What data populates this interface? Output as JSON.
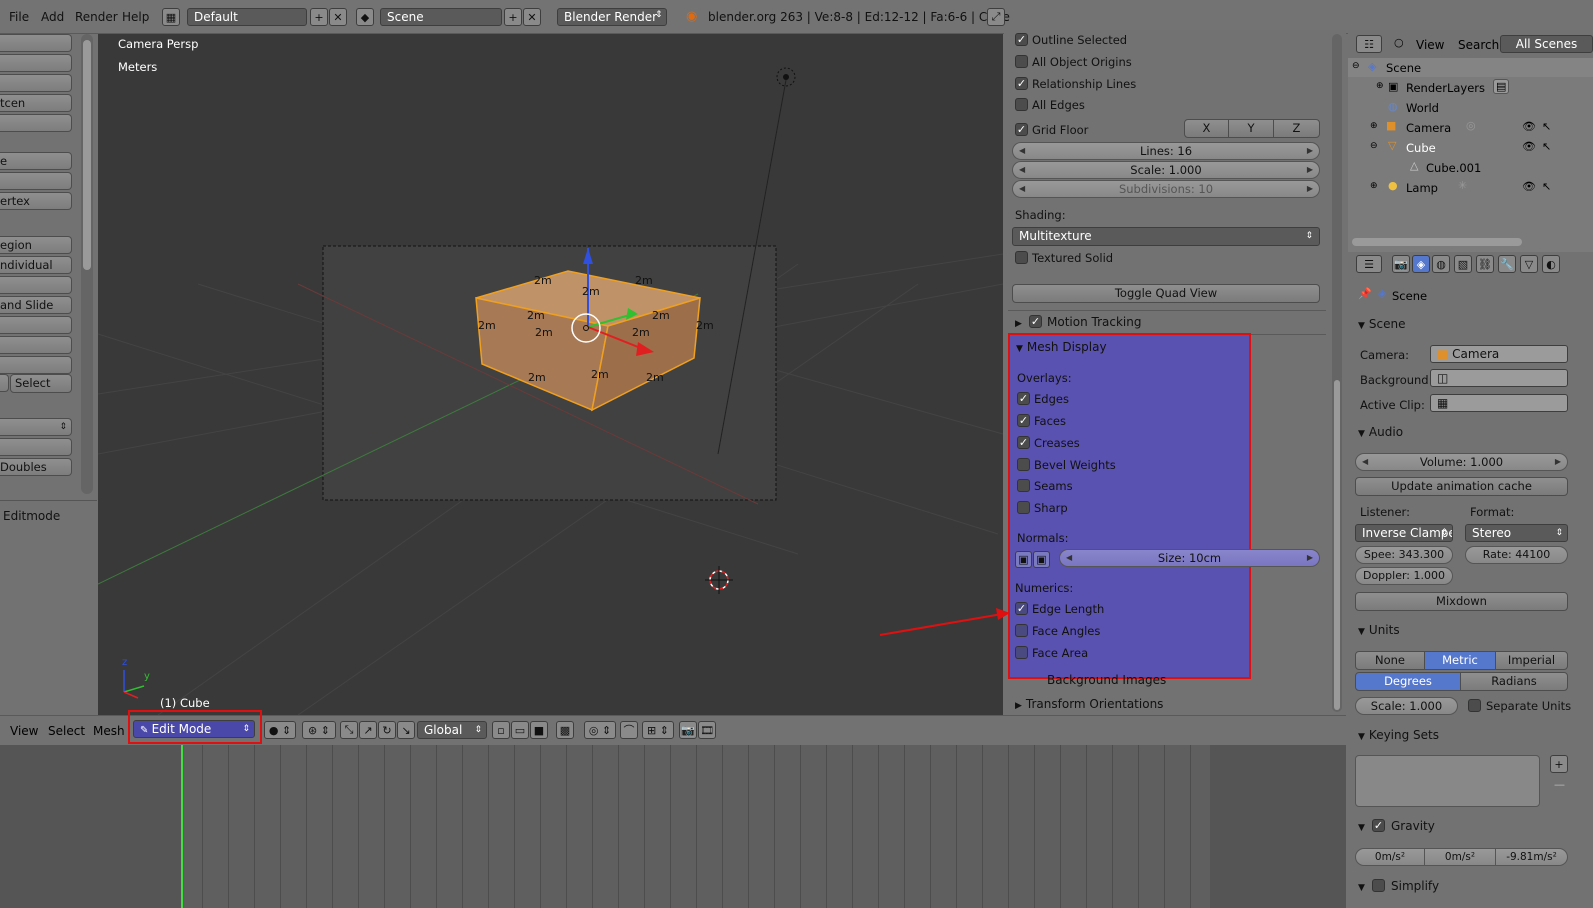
{
  "topbar": {
    "menus": [
      "File",
      "Add",
      "Render",
      "Help"
    ],
    "layout": "Default",
    "scene": "Scene",
    "engine": "Blender Render",
    "stats": "blender.org 263 | Ve:8-8 | Ed:12-12 | Fa:6-6 | Cube"
  },
  "left_panel": {
    "items": [
      "",
      "",
      "",
      "tcen",
      "",
      "",
      "e",
      "",
      "ertex",
      "",
      "egion",
      "ndividual",
      "",
      "and Slide",
      "",
      "",
      "",
      ""
    ],
    "select_label": "Select",
    "doubles_label": "Doubles",
    "editmode_label": "Editmode"
  },
  "viewport": {
    "view_name": "Camera Persp",
    "units": "Meters",
    "object_label": "(1) Cube",
    "edge_labels": [
      "2m",
      "2m",
      "2m",
      "2m",
      "2m",
      "2m",
      "2m",
      "2m",
      "2m",
      "2m",
      "2m",
      "2m"
    ],
    "axis_z": "z",
    "axis_y": "y"
  },
  "npanel": {
    "display_checks": [
      {
        "label": "Outline Selected",
        "checked": true
      },
      {
        "label": "All Object Origins",
        "checked": false
      },
      {
        "label": "Relationship Lines",
        "checked": true
      },
      {
        "label": "All Edges",
        "checked": false
      }
    ],
    "grid_floor": {
      "label": "Grid Floor",
      "checked": true,
      "x": "X",
      "y": "Y",
      "z": "Z"
    },
    "lines": "Lines: 16",
    "scale": "Scale: 1.000",
    "subdivisions": "Subdivisions: 10",
    "shading_label": "Shading:",
    "shading_value": "Multitexture",
    "textured_solid": "Textured Solid",
    "toggle_quad": "Toggle Quad View",
    "motion_tracking": "Motion Tracking",
    "mesh_display": "Mesh Display",
    "overlays_label": "Overlays:",
    "overlays": [
      {
        "label": "Edges",
        "checked": true
      },
      {
        "label": "Faces",
        "checked": true
      },
      {
        "label": "Creases",
        "checked": true
      },
      {
        "label": "Bevel Weights",
        "checked": false
      },
      {
        "label": "Seams",
        "checked": false
      },
      {
        "label": "Sharp",
        "checked": false
      }
    ],
    "normals_label": "Normals:",
    "normals_size": "Size: 10cm",
    "numerics_label": "Numerics:",
    "numerics": [
      {
        "label": "Edge Length",
        "checked": true
      },
      {
        "label": "Face Angles",
        "checked": false
      },
      {
        "label": "Face Area",
        "checked": false
      }
    ],
    "background_images": "Background Images",
    "transform_orientations": "Transform Orientations"
  },
  "outliner": {
    "view": "View",
    "search": "Search",
    "all_scenes": "All Scenes",
    "tree": [
      {
        "label": "Scene",
        "indent": 0
      },
      {
        "label": "RenderLayers",
        "indent": 1
      },
      {
        "label": "World",
        "indent": 1
      },
      {
        "label": "Camera",
        "indent": 1
      },
      {
        "label": "Cube",
        "indent": 1
      },
      {
        "label": "Cube.001",
        "indent": 2
      },
      {
        "label": "Lamp",
        "indent": 1
      }
    ]
  },
  "properties": {
    "breadcrumb": "Scene",
    "scene_section": "Scene",
    "camera_label": "Camera:",
    "camera_value": "Camera",
    "background_label": "Background:",
    "active_clip_label": "Active Clip:",
    "audio_section": "Audio",
    "volume": "Volume: 1.000",
    "update_cache": "Update animation cache",
    "listener_label": "Listener:",
    "format_label": "Format:",
    "listener_value": "Inverse Clampe",
    "format_value": "Stereo",
    "speed": "Spee: 343.300",
    "rate": "Rate: 44100",
    "doppler": "Doppler: 1.000",
    "mixdown": "Mixdown",
    "units_section": "Units",
    "unit_none": "None",
    "unit_metric": "Metric",
    "unit_imperial": "Imperial",
    "degrees": "Degrees",
    "radians": "Radians",
    "unit_scale": "Scale: 1.000",
    "separate_units": "Separate Units",
    "keying_sets": "Keying Sets",
    "gravity": "Gravity",
    "gravity_x": "0m/s²",
    "gravity_y": "0m/s²",
    "gravity_z": "-9.81m/s²",
    "simplify": "Simplify"
  },
  "header3d": {
    "view": "View",
    "select": "Select",
    "mesh": "Mesh",
    "mode": "Edit Mode",
    "orientation": "Global"
  },
  "colors": {
    "highlight_border": "#e01010",
    "mesh_overlay": "#5a52b0",
    "accent_blue": "#5577cc",
    "cube_face": "#b08058",
    "edge_orange": "#f0a020"
  }
}
